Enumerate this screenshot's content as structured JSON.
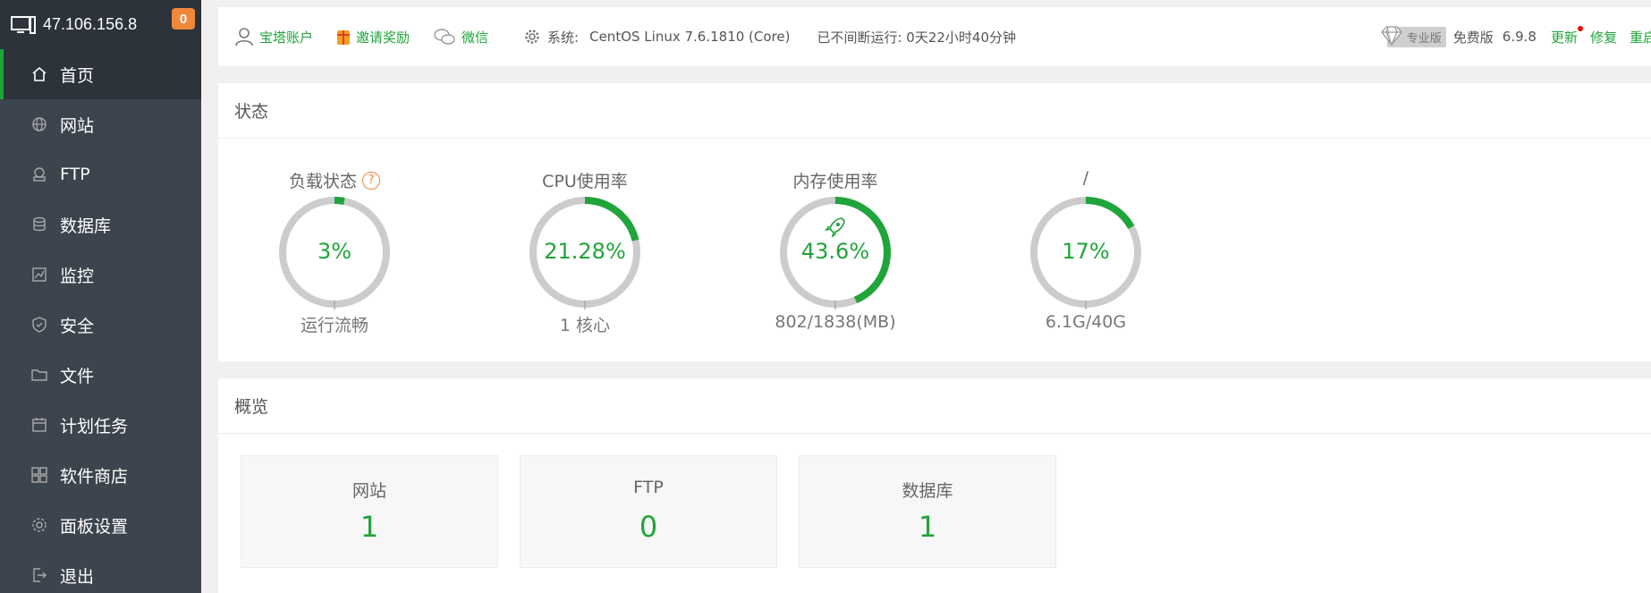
{
  "sidebar": {
    "ip": "47.106.156.8",
    "badge": "0",
    "items": [
      {
        "label": "首页",
        "icon": "home-icon"
      },
      {
        "label": "网站",
        "icon": "globe-icon"
      },
      {
        "label": "FTP",
        "icon": "ftp-icon"
      },
      {
        "label": "数据库",
        "icon": "database-icon"
      },
      {
        "label": "监控",
        "icon": "monitor-chart-icon"
      },
      {
        "label": "安全",
        "icon": "shield-icon"
      },
      {
        "label": "文件",
        "icon": "folder-icon"
      },
      {
        "label": "计划任务",
        "icon": "calendar-icon"
      },
      {
        "label": "软件商店",
        "icon": "grid-icon"
      },
      {
        "label": "面板设置",
        "icon": "gear-icon"
      },
      {
        "label": "退出",
        "icon": "logout-icon"
      }
    ]
  },
  "topbar": {
    "account": "宝塔账户",
    "invite": "邀请奖励",
    "wechat": "微信",
    "system_label": "系统:",
    "system_value": "CentOS Linux 7.6.1810 (Core)",
    "uptime": "已不间断运行: 0天22小时40分钟",
    "pro": "专业版",
    "free": "免费版",
    "version": "6.9.8",
    "update": "更新",
    "repair": "修复",
    "restart": "重启"
  },
  "status": {
    "title": "状态",
    "gauges": [
      {
        "title": "负载状态",
        "value": "3%",
        "fraction": 0.03,
        "sub": "运行流畅",
        "help": "?"
      },
      {
        "title": "CPU使用率",
        "value": "21.28%",
        "fraction": 0.2128,
        "sub": "1 核心"
      },
      {
        "title": "内存使用率",
        "value": "43.6%",
        "fraction": 0.436,
        "sub": "802/1838(MB)"
      },
      {
        "title": "/",
        "value": "17%",
        "fraction": 0.17,
        "sub": "6.1G/40G"
      }
    ]
  },
  "overview": {
    "title": "概览",
    "cards": [
      {
        "title": "网站",
        "value": "1"
      },
      {
        "title": "FTP",
        "value": "0"
      },
      {
        "title": "数据库",
        "value": "1"
      }
    ]
  },
  "colors": {
    "accent": "#20a53a",
    "sidebar": "#3c444d",
    "badge": "#f0883a",
    "ring_bg": "#cccccc"
  }
}
